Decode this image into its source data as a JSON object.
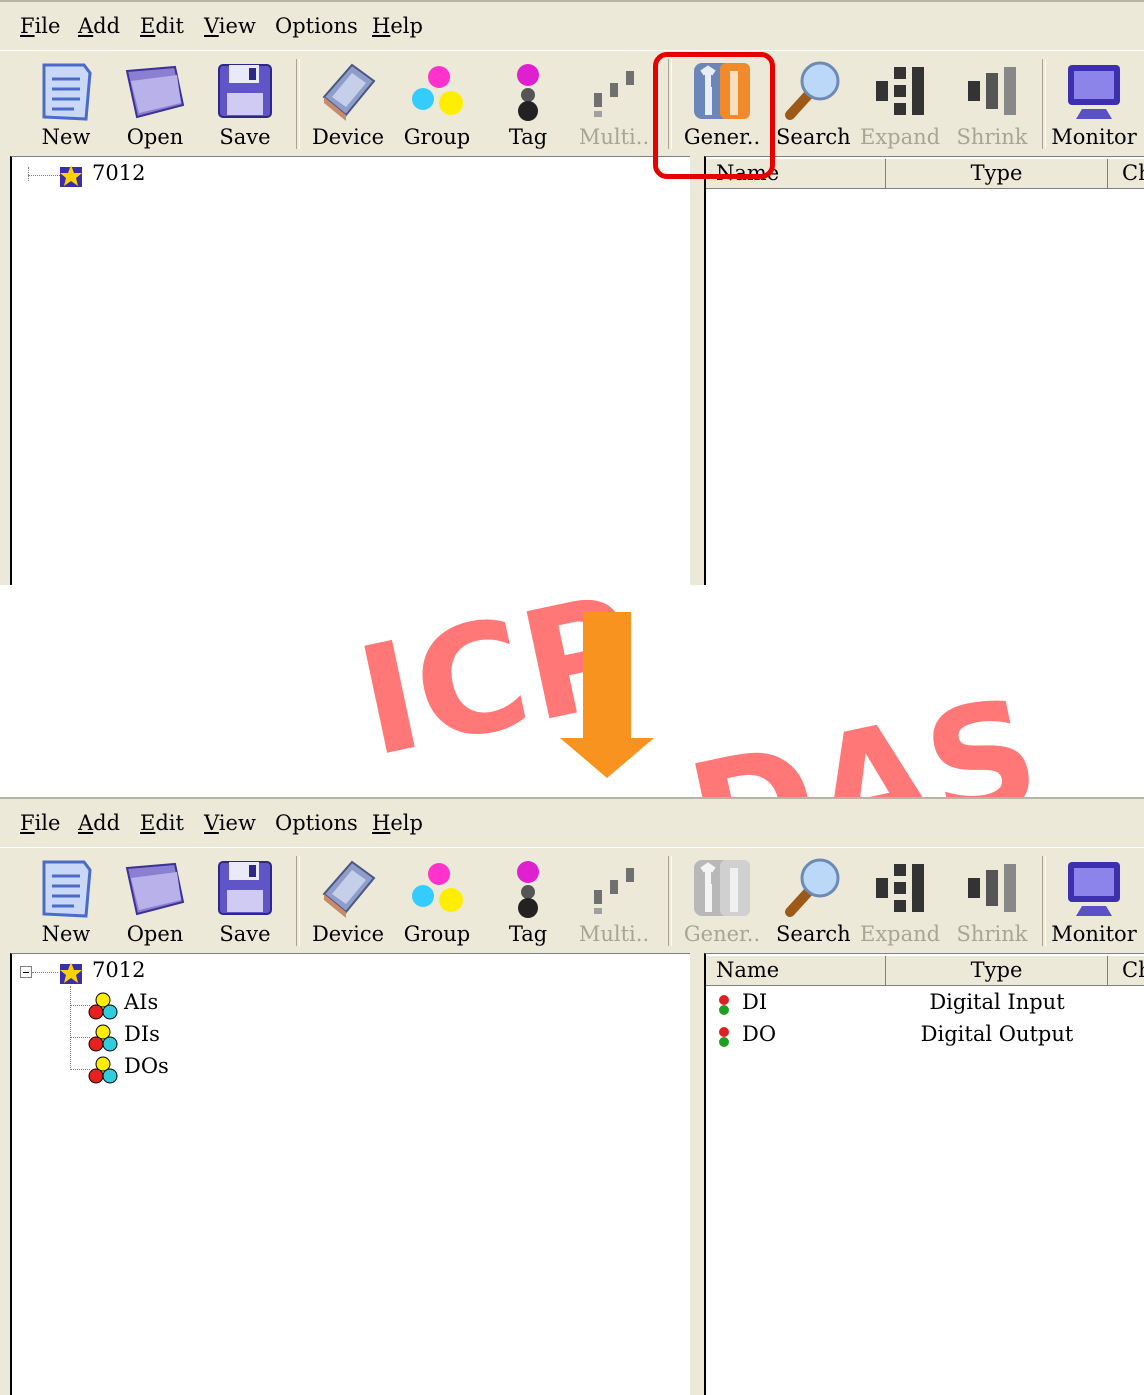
{
  "menu": [
    {
      "accel": "F",
      "rest": "ile"
    },
    {
      "accel": "A",
      "rest": "dd"
    },
    {
      "accel": "E",
      "rest": "dit"
    },
    {
      "accel": "V",
      "rest": "iew"
    },
    {
      "pre": "Options",
      "accel": "",
      "rest": ""
    },
    {
      "accel": "H",
      "rest": "elp"
    }
  ],
  "toolbar_top": {
    "new": "New",
    "open": "Open",
    "save": "Save",
    "device": "Device",
    "group": "Group",
    "tag": "Tag",
    "multi": "Multi..",
    "gener": "Gener..",
    "search": "Search",
    "expand": "Expand",
    "shrink": "Shrink",
    "monitor": "Monitor"
  },
  "toolbar_bottom": {
    "new": "New",
    "open": "Open",
    "save": "Save",
    "device": "Device",
    "group": "Group",
    "tag": "Tag",
    "multi": "Multi..",
    "gener": "Gener..",
    "search": "Search",
    "expand": "Expand",
    "shrink": "Shrink",
    "monitor": "Monitor"
  },
  "top": {
    "tree_root": "7012",
    "columns": {
      "name": "Name",
      "type": "Type",
      "ch": "Ch"
    }
  },
  "bottom": {
    "tree_root": "7012",
    "tree_children": [
      "AIs",
      "DIs",
      "DOs"
    ],
    "columns": {
      "name": "Name",
      "type": "Type",
      "ch": "Ch"
    },
    "rows": [
      {
        "name": "DI",
        "type": "Digital Input"
      },
      {
        "name": "DO",
        "type": "Digital Output"
      }
    ]
  },
  "watermark": {
    "line1": "ICP",
    "line2": "DAS"
  },
  "colors": {
    "highlight": "#e60000",
    "arrow": "#f7931e",
    "chrome": "#ece9d8"
  }
}
